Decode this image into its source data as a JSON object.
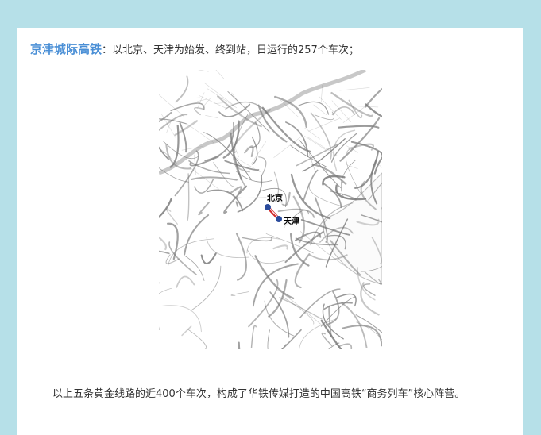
{
  "article": {
    "heading_title": "京津城际高铁",
    "heading_rest": "：以北京、天津为始发、终到站，日运行的257个车次；",
    "paragraph": "以上五条黄金线路的近400个车次，构成了华铁传媒打造的中国高铁“商务列车”核心阵营。"
  },
  "map": {
    "labels": {
      "beijing": "北京",
      "tianjin": "天津"
    },
    "colors": {
      "route": "#d22b2b",
      "station": "#2a4b9c",
      "network": "#7a7a7a"
    }
  }
}
